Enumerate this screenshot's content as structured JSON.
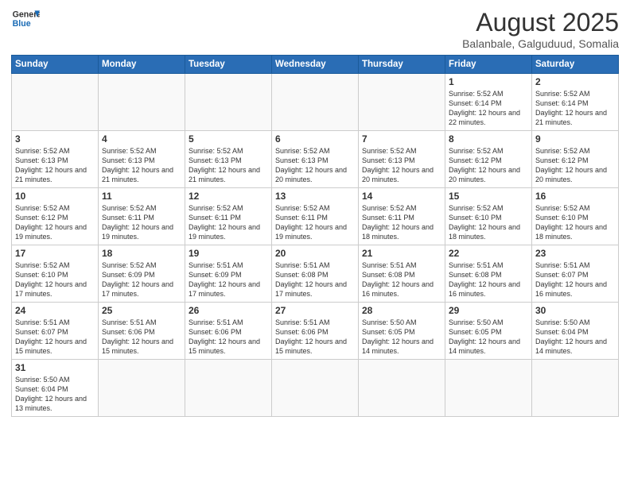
{
  "logo": {
    "text_general": "General",
    "text_blue": "Blue"
  },
  "header": {
    "month_year": "August 2025",
    "location": "Balanbale, Galguduud, Somalia"
  },
  "weekdays": [
    "Sunday",
    "Monday",
    "Tuesday",
    "Wednesday",
    "Thursday",
    "Friday",
    "Saturday"
  ],
  "weeks": [
    [
      {
        "day": "",
        "info": ""
      },
      {
        "day": "",
        "info": ""
      },
      {
        "day": "",
        "info": ""
      },
      {
        "day": "",
        "info": ""
      },
      {
        "day": "",
        "info": ""
      },
      {
        "day": "1",
        "info": "Sunrise: 5:52 AM\nSunset: 6:14 PM\nDaylight: 12 hours\nand 22 minutes."
      },
      {
        "day": "2",
        "info": "Sunrise: 5:52 AM\nSunset: 6:14 PM\nDaylight: 12 hours\nand 21 minutes."
      }
    ],
    [
      {
        "day": "3",
        "info": "Sunrise: 5:52 AM\nSunset: 6:13 PM\nDaylight: 12 hours\nand 21 minutes."
      },
      {
        "day": "4",
        "info": "Sunrise: 5:52 AM\nSunset: 6:13 PM\nDaylight: 12 hours\nand 21 minutes."
      },
      {
        "day": "5",
        "info": "Sunrise: 5:52 AM\nSunset: 6:13 PM\nDaylight: 12 hours\nand 21 minutes."
      },
      {
        "day": "6",
        "info": "Sunrise: 5:52 AM\nSunset: 6:13 PM\nDaylight: 12 hours\nand 20 minutes."
      },
      {
        "day": "7",
        "info": "Sunrise: 5:52 AM\nSunset: 6:13 PM\nDaylight: 12 hours\nand 20 minutes."
      },
      {
        "day": "8",
        "info": "Sunrise: 5:52 AM\nSunset: 6:12 PM\nDaylight: 12 hours\nand 20 minutes."
      },
      {
        "day": "9",
        "info": "Sunrise: 5:52 AM\nSunset: 6:12 PM\nDaylight: 12 hours\nand 20 minutes."
      }
    ],
    [
      {
        "day": "10",
        "info": "Sunrise: 5:52 AM\nSunset: 6:12 PM\nDaylight: 12 hours\nand 19 minutes."
      },
      {
        "day": "11",
        "info": "Sunrise: 5:52 AM\nSunset: 6:11 PM\nDaylight: 12 hours\nand 19 minutes."
      },
      {
        "day": "12",
        "info": "Sunrise: 5:52 AM\nSunset: 6:11 PM\nDaylight: 12 hours\nand 19 minutes."
      },
      {
        "day": "13",
        "info": "Sunrise: 5:52 AM\nSunset: 6:11 PM\nDaylight: 12 hours\nand 19 minutes."
      },
      {
        "day": "14",
        "info": "Sunrise: 5:52 AM\nSunset: 6:11 PM\nDaylight: 12 hours\nand 18 minutes."
      },
      {
        "day": "15",
        "info": "Sunrise: 5:52 AM\nSunset: 6:10 PM\nDaylight: 12 hours\nand 18 minutes."
      },
      {
        "day": "16",
        "info": "Sunrise: 5:52 AM\nSunset: 6:10 PM\nDaylight: 12 hours\nand 18 minutes."
      }
    ],
    [
      {
        "day": "17",
        "info": "Sunrise: 5:52 AM\nSunset: 6:10 PM\nDaylight: 12 hours\nand 17 minutes."
      },
      {
        "day": "18",
        "info": "Sunrise: 5:52 AM\nSunset: 6:09 PM\nDaylight: 12 hours\nand 17 minutes."
      },
      {
        "day": "19",
        "info": "Sunrise: 5:51 AM\nSunset: 6:09 PM\nDaylight: 12 hours\nand 17 minutes."
      },
      {
        "day": "20",
        "info": "Sunrise: 5:51 AM\nSunset: 6:08 PM\nDaylight: 12 hours\nand 17 minutes."
      },
      {
        "day": "21",
        "info": "Sunrise: 5:51 AM\nSunset: 6:08 PM\nDaylight: 12 hours\nand 16 minutes."
      },
      {
        "day": "22",
        "info": "Sunrise: 5:51 AM\nSunset: 6:08 PM\nDaylight: 12 hours\nand 16 minutes."
      },
      {
        "day": "23",
        "info": "Sunrise: 5:51 AM\nSunset: 6:07 PM\nDaylight: 12 hours\nand 16 minutes."
      }
    ],
    [
      {
        "day": "24",
        "info": "Sunrise: 5:51 AM\nSunset: 6:07 PM\nDaylight: 12 hours\nand 15 minutes."
      },
      {
        "day": "25",
        "info": "Sunrise: 5:51 AM\nSunset: 6:06 PM\nDaylight: 12 hours\nand 15 minutes."
      },
      {
        "day": "26",
        "info": "Sunrise: 5:51 AM\nSunset: 6:06 PM\nDaylight: 12 hours\nand 15 minutes."
      },
      {
        "day": "27",
        "info": "Sunrise: 5:51 AM\nSunset: 6:06 PM\nDaylight: 12 hours\nand 15 minutes."
      },
      {
        "day": "28",
        "info": "Sunrise: 5:50 AM\nSunset: 6:05 PM\nDaylight: 12 hours\nand 14 minutes."
      },
      {
        "day": "29",
        "info": "Sunrise: 5:50 AM\nSunset: 6:05 PM\nDaylight: 12 hours\nand 14 minutes."
      },
      {
        "day": "30",
        "info": "Sunrise: 5:50 AM\nSunset: 6:04 PM\nDaylight: 12 hours\nand 14 minutes."
      }
    ],
    [
      {
        "day": "31",
        "info": "Sunrise: 5:50 AM\nSunset: 6:04 PM\nDaylight: 12 hours\nand 13 minutes."
      },
      {
        "day": "",
        "info": ""
      },
      {
        "day": "",
        "info": ""
      },
      {
        "day": "",
        "info": ""
      },
      {
        "day": "",
        "info": ""
      },
      {
        "day": "",
        "info": ""
      },
      {
        "day": "",
        "info": ""
      }
    ]
  ]
}
